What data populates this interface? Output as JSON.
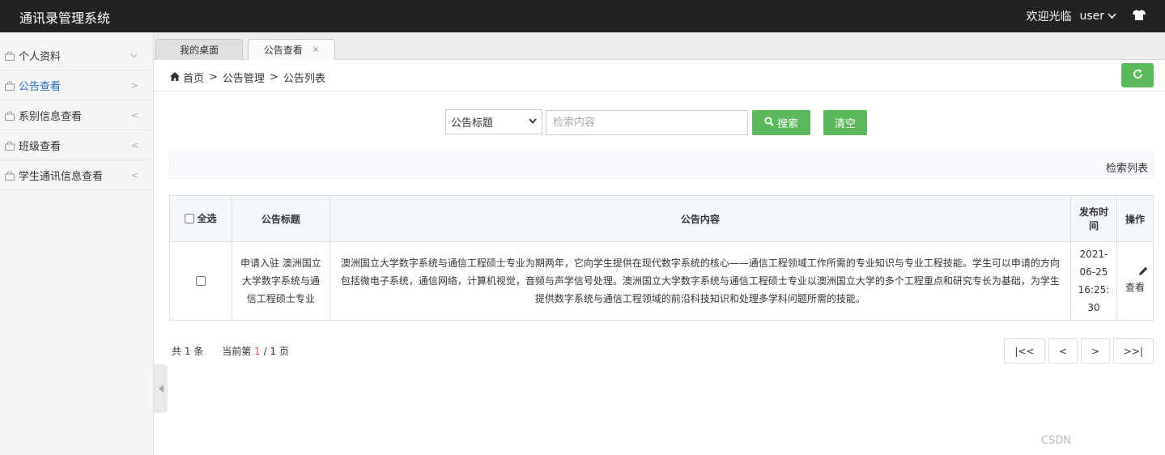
{
  "app": {
    "title": "通讯录管理系统"
  },
  "topbar": {
    "welcome": "欢迎光临",
    "user": "user",
    "chevron": "chevron-down-icon",
    "shirt": "shirt-icon"
  },
  "sidebar": {
    "items": [
      {
        "label": "个人资料",
        "arrow": "∨",
        "active": false
      },
      {
        "label": "公告查看",
        "arrow": ">",
        "active": true
      },
      {
        "label": "系别信息查看",
        "arrow": "<",
        "active": false
      },
      {
        "label": "班级查看",
        "arrow": "<",
        "active": false
      },
      {
        "label": "学生通讯信息查看",
        "arrow": "<",
        "active": false
      }
    ]
  },
  "tabs": [
    {
      "label": "我的桌面",
      "active": false
    },
    {
      "label": "公告查看",
      "active": true,
      "close": "×"
    }
  ],
  "breadcrumb": {
    "home": "首页",
    "level1": "公告管理",
    "level2": "公告列表",
    "sep": ">"
  },
  "search": {
    "field_selected": "公告标题",
    "placeholder": "检索内容",
    "search_label": "搜索",
    "clear_label": "清空"
  },
  "list": {
    "header": "检索列表",
    "columns": {
      "select_all": "全选",
      "title": "公告标题",
      "content": "公告内容",
      "time_l1": "发布时",
      "time_l2": "间",
      "op": "操作"
    },
    "rows": [
      {
        "title": "申请入驻 澳洲国立大学数字系统与通信工程硕士专业",
        "content": "澳洲国立大学数字系统与通信工程硕士专业为期两年，它向学生提供在现代数字系统的核心——通信工程领域工作所需的专业知识与专业工程技能。学生可以申请的方向包括微电子系统，通信网络，计算机视觉，音频与声学信号处理。澳洲国立大学数字系统与通信工程硕士专业以澳洲国立大学的多个工程重点和研究专长为基础，为学生提供数字系统与通信工程领域的前沿科技知识和处理多学科问题所需的技能。",
        "time_parts": [
          "2021-",
          "06-25",
          "16:25:",
          "30"
        ],
        "op_label": "查看"
      }
    ]
  },
  "pagination": {
    "total_prefix": "共",
    "total_count": "1",
    "total_suffix": "条",
    "current_prefix": "当前第",
    "current": "1",
    "pages": "/ 1 页",
    "first": "|<<",
    "prev": "<",
    "next": ">",
    "last": ">>|"
  },
  "watermark": "CSDN",
  "colors": {
    "topbar": "#222222",
    "accent_green": "#5cb85c",
    "active_link": "#2a6ebb",
    "current_page": "#d9534f"
  }
}
